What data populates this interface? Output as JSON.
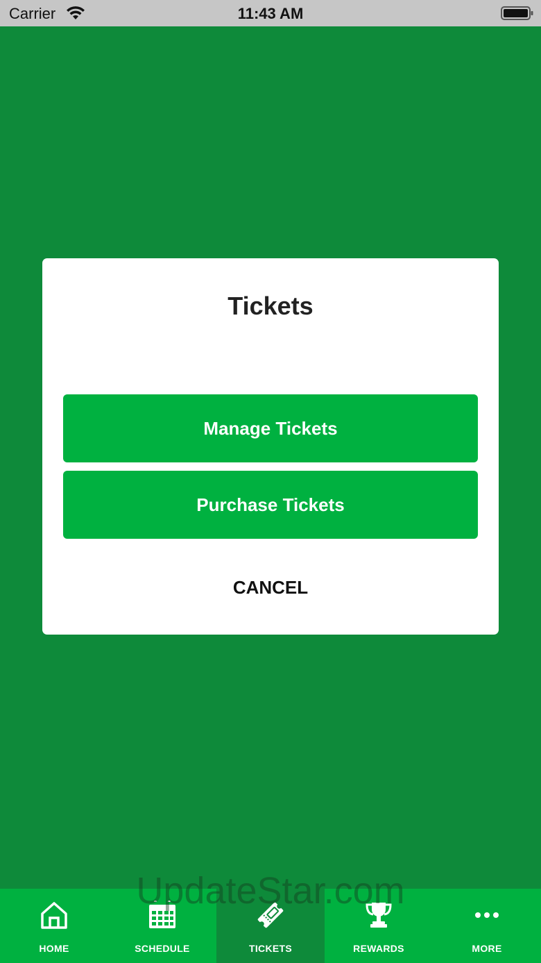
{
  "status_bar": {
    "carrier": "Carrier",
    "time": "11:43 AM"
  },
  "modal": {
    "title": "Tickets",
    "manage_label": "Manage Tickets",
    "purchase_label": "Purchase Tickets",
    "cancel_label": "CANCEL"
  },
  "tab_bar": {
    "tabs": [
      {
        "label": "HOME",
        "icon": "home-icon"
      },
      {
        "label": "SCHEDULE",
        "icon": "calendar-icon"
      },
      {
        "label": "TICKETS",
        "icon": "ticket-icon",
        "active": true
      },
      {
        "label": "REWARDS",
        "icon": "trophy-icon"
      },
      {
        "label": "MORE",
        "icon": "more-icon"
      }
    ]
  },
  "watermark": "UpdateStar.com",
  "colors": {
    "background": "#0e8a3a",
    "accent": "#00b140",
    "status_bar": "#c6c6c6"
  }
}
